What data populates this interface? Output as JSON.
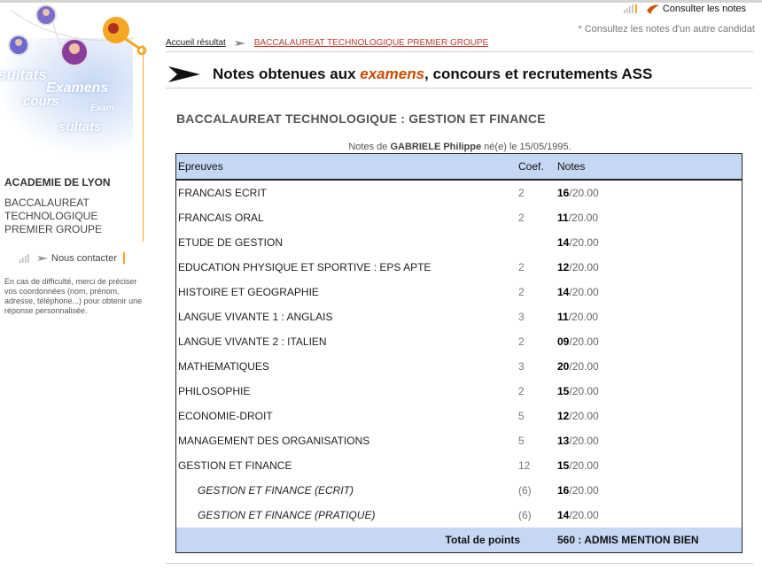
{
  "header": {
    "consult_label": "Consulter les notes",
    "consult_other": "* Consultez les notes d'un autre candidat"
  },
  "breadcrumb": {
    "home": "Accueil résultat",
    "current": "BACCALAUREAT TECHNOLOGIQUE PREMIER GROUPE"
  },
  "page_title": {
    "before": "Notes obtenues aux ",
    "emphasis": "examens",
    "after": ", concours et recrutements ASS"
  },
  "sidebar": {
    "logo_words": [
      "sultats",
      "Examens",
      "cours",
      "Exam",
      "sultats"
    ],
    "academy": "ACADEMIE DE LYON",
    "exam_name": "BACCALAUREAT TECHNOLOGIQUE PREMIER GROUPE",
    "contact_label": "Nous contacter",
    "help_text": "En cas de difficulté, merci de préciser vos coordonnées (nom, prénom, adresse, téléphone...) pour obtenir une réponse personnalisée."
  },
  "exam": {
    "section_title": "BACCALAUREAT TECHNOLOGIQUE : GESTION ET FINANCE",
    "candidate_prefix": "Notes de ",
    "candidate_name": "GABRIELE Philippe",
    "candidate_suffix": " né(e) le 15/05/1995."
  },
  "table": {
    "headers": {
      "subject": "Epreuves",
      "coef": "Coef.",
      "notes": "Notes"
    },
    "rows": [
      {
        "subject": "FRANCAIS ECRIT",
        "coef": "2",
        "score": "16",
        "max": "/20.00",
        "sub": false
      },
      {
        "subject": "FRANCAIS ORAL",
        "coef": "2",
        "score": "11",
        "max": "/20.00",
        "sub": false
      },
      {
        "subject": "ETUDE DE GESTION",
        "coef": "",
        "score": "14",
        "max": "/20.00",
        "sub": false
      },
      {
        "subject": "EDUCATION PHYSIQUE ET SPORTIVE : EPS APTE",
        "coef": "2",
        "score": "12",
        "max": "/20.00",
        "sub": false
      },
      {
        "subject": "HISTOIRE ET GEOGRAPHIE",
        "coef": "2",
        "score": "14",
        "max": "/20.00",
        "sub": false
      },
      {
        "subject": "LANGUE VIVANTE 1 : ANGLAIS",
        "coef": "3",
        "score": "11",
        "max": "/20.00",
        "sub": false
      },
      {
        "subject": "LANGUE VIVANTE 2 : ITALIEN",
        "coef": "2",
        "score": "09",
        "max": "/20.00",
        "sub": false
      },
      {
        "subject": "MATHEMATIQUES",
        "coef": "3",
        "score": "20",
        "max": "/20.00",
        "sub": false
      },
      {
        "subject": "PHILOSOPHIE",
        "coef": "2",
        "score": "15",
        "max": "/20.00",
        "sub": false
      },
      {
        "subject": "ECONOMIE-DROIT",
        "coef": "5",
        "score": "12",
        "max": "/20.00",
        "sub": false
      },
      {
        "subject": "MANAGEMENT DES ORGANISATIONS",
        "coef": "5",
        "score": "13",
        "max": "/20.00",
        "sub": false
      },
      {
        "subject": "GESTION ET FINANCE",
        "coef": "12",
        "score": "15",
        "max": "/20.00",
        "sub": false
      },
      {
        "subject": "GESTION ET FINANCE (ECRIT)",
        "coef": "(6)",
        "score": "16",
        "max": "/20.00",
        "sub": true
      },
      {
        "subject": "GESTION ET FINANCE (PRATIQUE)",
        "coef": "(6)",
        "score": "14",
        "max": "/20.00",
        "sub": true
      }
    ],
    "total_label": "Total de points",
    "total_value": "560 : ADMIS MENTION BIEN"
  },
  "colors": {
    "header_fill": "#c5d7f3",
    "accent_orange": "#f5a623",
    "emphasis": "#cc4a00",
    "breadcrumb_current": "#c0392b"
  },
  "icons": [
    "signal-bars-icon",
    "swoosh-arrow-icon",
    "breadcrumb-arrow-icon",
    "title-arrow-icon",
    "avatar-photo"
  ]
}
